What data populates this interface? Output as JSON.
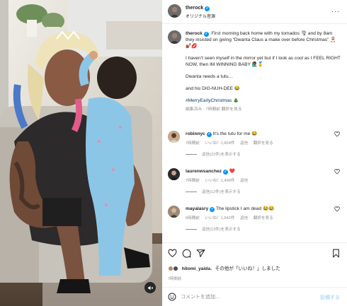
{
  "post": {
    "account": "therock",
    "audio_label": "オリジナル音源",
    "colors": {
      "verified": "#0095f6",
      "hashtag": "#00376b",
      "meta": "#8e8e8e",
      "post_button": "#b2dffc"
    }
  },
  "caption": {
    "username": "therock",
    "p1": "First morning back home with my tornados 🌪 and by 8am they insisted on giving “Dwanta Claus a make over before Christmas” 🎅🏾💅🏾💋",
    "p2": "I haven’t seen myself in the mirror yet but if I look as cool as I FEEL RIGHT NOW, then IM WINNING BABY 🙋🏾‍♂️🏅",
    "p3": "Dwanta needs a tutu…",
    "p4": "and his DIG-NUH-DEE 😂",
    "hashtag": "#MerryEarlyChristmas 🎄",
    "meta": "編集済み · 7時間前  翻訳を見る"
  },
  "comments": [
    {
      "username": "robinnyc",
      "text": "It's the tutu for me 😂",
      "time": "7時間前",
      "likes": "いいね！1,824件",
      "reply": "返信",
      "translate": "翻訳を見る",
      "replies": "返信(22件)を表示する"
    },
    {
      "username": "laurenwsanchez",
      "text": "❤️",
      "time": "7時間前",
      "likes": "いいね！1,499件",
      "reply": "返信",
      "translate": "",
      "replies": "返信(12件)を表示する"
    },
    {
      "username": "mayalasry",
      "text": "The lipstick I am dead 😂😂",
      "time": "6時間前",
      "likes": "いいね！1,642件",
      "reply": "返信",
      "translate": "翻訳を見る",
      "replies": "返信(13件)を表示する"
    }
  ],
  "actions": {
    "icons": [
      "heart-icon",
      "comment-icon",
      "share-icon",
      "bookmark-icon"
    ],
    "liked_by_user": "hitomi_yaida",
    "liked_by_rest": "、その他が「いいね！」しました",
    "date": "7時間前"
  },
  "comment_box": {
    "placeholder": "コメントを追加...",
    "post_label": "投稿する"
  }
}
